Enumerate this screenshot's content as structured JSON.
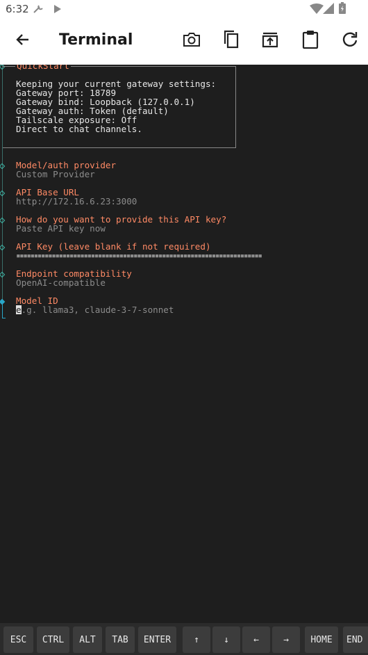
{
  "status_bar": {
    "time": "6:32"
  },
  "app_bar": {
    "title": "Terminal",
    "icons": [
      "back-arrow-icon",
      "camera-icon",
      "copy-icon",
      "open-in-icon",
      "clipboard-icon",
      "refresh-icon"
    ]
  },
  "terminal": {
    "quickstart": {
      "title": "QuickStart",
      "lines": [
        "Keeping your current gateway settings:",
        "Gateway port: 18789",
        "Gateway bind: Loopback (127.0.0.1)",
        "Gateway auth: Token (default)",
        "Tailscale exposure: Off",
        "Direct to chat channels."
      ]
    },
    "prompts": [
      {
        "label": "Model/auth provider",
        "value": "Custom Provider"
      },
      {
        "label": "API Base URL",
        "value": "http://172.16.6.23:3000"
      },
      {
        "label": "How do you want to provide this API key?",
        "value": "Paste API key now"
      },
      {
        "label": "API Key (leave blank if not required)",
        "value": "▪▪▪▪▪▪▪▪▪▪▪▪▪▪▪▪▪▪▪▪▪▪▪▪▪▪▪▪▪▪▪▪▪▪▪▪▪▪▪▪▪▪▪▪▪▪▪▪▪▪▪▪▪▪▪▪▪▪▪▪▪▪▪▪▪▪▪▪▪"
      },
      {
        "label": "Endpoint compatibility",
        "value": "OpenAI-compatible"
      }
    ],
    "active_prompt": {
      "label": "Model ID",
      "cursor_char": "e",
      "placeholder_rest": ".g. llama3, claude-3-7-sonnet"
    }
  },
  "extra_keys": [
    "ESC",
    "CTRL",
    "ALT",
    "TAB",
    "ENTER",
    "↑",
    "↓",
    "←",
    "→",
    "HOME",
    "END"
  ],
  "colors": {
    "terminal_bg": "#1e1e1e",
    "label_orange": "#ff8a65",
    "value_gray": "#8c8c8c",
    "rail_teal": "#3fb8a8"
  }
}
